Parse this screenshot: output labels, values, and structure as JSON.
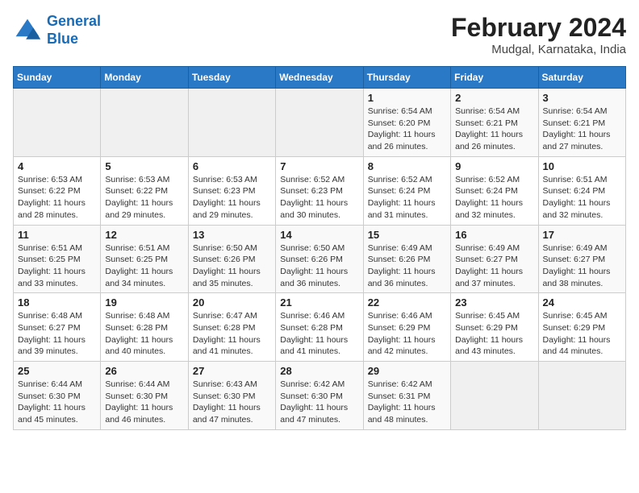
{
  "header": {
    "logo_line1": "General",
    "logo_line2": "Blue",
    "month": "February 2024",
    "location": "Mudgal, Karnataka, India"
  },
  "days_of_week": [
    "Sunday",
    "Monday",
    "Tuesday",
    "Wednesday",
    "Thursday",
    "Friday",
    "Saturday"
  ],
  "weeks": [
    [
      {
        "day": "",
        "info": ""
      },
      {
        "day": "",
        "info": ""
      },
      {
        "day": "",
        "info": ""
      },
      {
        "day": "",
        "info": ""
      },
      {
        "day": "1",
        "info": "Sunrise: 6:54 AM\nSunset: 6:20 PM\nDaylight: 11 hours\nand 26 minutes."
      },
      {
        "day": "2",
        "info": "Sunrise: 6:54 AM\nSunset: 6:21 PM\nDaylight: 11 hours\nand 26 minutes."
      },
      {
        "day": "3",
        "info": "Sunrise: 6:54 AM\nSunset: 6:21 PM\nDaylight: 11 hours\nand 27 minutes."
      }
    ],
    [
      {
        "day": "4",
        "info": "Sunrise: 6:53 AM\nSunset: 6:22 PM\nDaylight: 11 hours\nand 28 minutes."
      },
      {
        "day": "5",
        "info": "Sunrise: 6:53 AM\nSunset: 6:22 PM\nDaylight: 11 hours\nand 29 minutes."
      },
      {
        "day": "6",
        "info": "Sunrise: 6:53 AM\nSunset: 6:23 PM\nDaylight: 11 hours\nand 29 minutes."
      },
      {
        "day": "7",
        "info": "Sunrise: 6:52 AM\nSunset: 6:23 PM\nDaylight: 11 hours\nand 30 minutes."
      },
      {
        "day": "8",
        "info": "Sunrise: 6:52 AM\nSunset: 6:24 PM\nDaylight: 11 hours\nand 31 minutes."
      },
      {
        "day": "9",
        "info": "Sunrise: 6:52 AM\nSunset: 6:24 PM\nDaylight: 11 hours\nand 32 minutes."
      },
      {
        "day": "10",
        "info": "Sunrise: 6:51 AM\nSunset: 6:24 PM\nDaylight: 11 hours\nand 32 minutes."
      }
    ],
    [
      {
        "day": "11",
        "info": "Sunrise: 6:51 AM\nSunset: 6:25 PM\nDaylight: 11 hours\nand 33 minutes."
      },
      {
        "day": "12",
        "info": "Sunrise: 6:51 AM\nSunset: 6:25 PM\nDaylight: 11 hours\nand 34 minutes."
      },
      {
        "day": "13",
        "info": "Sunrise: 6:50 AM\nSunset: 6:26 PM\nDaylight: 11 hours\nand 35 minutes."
      },
      {
        "day": "14",
        "info": "Sunrise: 6:50 AM\nSunset: 6:26 PM\nDaylight: 11 hours\nand 36 minutes."
      },
      {
        "day": "15",
        "info": "Sunrise: 6:49 AM\nSunset: 6:26 PM\nDaylight: 11 hours\nand 36 minutes."
      },
      {
        "day": "16",
        "info": "Sunrise: 6:49 AM\nSunset: 6:27 PM\nDaylight: 11 hours\nand 37 minutes."
      },
      {
        "day": "17",
        "info": "Sunrise: 6:49 AM\nSunset: 6:27 PM\nDaylight: 11 hours\nand 38 minutes."
      }
    ],
    [
      {
        "day": "18",
        "info": "Sunrise: 6:48 AM\nSunset: 6:27 PM\nDaylight: 11 hours\nand 39 minutes."
      },
      {
        "day": "19",
        "info": "Sunrise: 6:48 AM\nSunset: 6:28 PM\nDaylight: 11 hours\nand 40 minutes."
      },
      {
        "day": "20",
        "info": "Sunrise: 6:47 AM\nSunset: 6:28 PM\nDaylight: 11 hours\nand 41 minutes."
      },
      {
        "day": "21",
        "info": "Sunrise: 6:46 AM\nSunset: 6:28 PM\nDaylight: 11 hours\nand 41 minutes."
      },
      {
        "day": "22",
        "info": "Sunrise: 6:46 AM\nSunset: 6:29 PM\nDaylight: 11 hours\nand 42 minutes."
      },
      {
        "day": "23",
        "info": "Sunrise: 6:45 AM\nSunset: 6:29 PM\nDaylight: 11 hours\nand 43 minutes."
      },
      {
        "day": "24",
        "info": "Sunrise: 6:45 AM\nSunset: 6:29 PM\nDaylight: 11 hours\nand 44 minutes."
      }
    ],
    [
      {
        "day": "25",
        "info": "Sunrise: 6:44 AM\nSunset: 6:30 PM\nDaylight: 11 hours\nand 45 minutes."
      },
      {
        "day": "26",
        "info": "Sunrise: 6:44 AM\nSunset: 6:30 PM\nDaylight: 11 hours\nand 46 minutes."
      },
      {
        "day": "27",
        "info": "Sunrise: 6:43 AM\nSunset: 6:30 PM\nDaylight: 11 hours\nand 47 minutes."
      },
      {
        "day": "28",
        "info": "Sunrise: 6:42 AM\nSunset: 6:30 PM\nDaylight: 11 hours\nand 47 minutes."
      },
      {
        "day": "29",
        "info": "Sunrise: 6:42 AM\nSunset: 6:31 PM\nDaylight: 11 hours\nand 48 minutes."
      },
      {
        "day": "",
        "info": ""
      },
      {
        "day": "",
        "info": ""
      }
    ]
  ]
}
